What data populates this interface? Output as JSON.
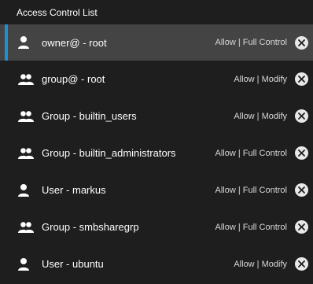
{
  "header": {
    "title": "Access Control List"
  },
  "acl": {
    "entries": [
      {
        "label": "owner@ - root",
        "permission": "Allow | Full Control",
        "icon": "person-icon",
        "selected": true
      },
      {
        "label": "group@ - root",
        "permission": "Allow | Modify",
        "icon": "group-icon"
      },
      {
        "label": "Group - builtin_users",
        "permission": "Allow | Modify",
        "icon": "group-icon"
      },
      {
        "label": "Group - builtin_administrators",
        "permission": "Allow | Full Control",
        "icon": "group-icon"
      },
      {
        "label": "User - markus",
        "permission": "Allow | Full Control",
        "icon": "person-icon"
      },
      {
        "label": "Group - smbsharegrp",
        "permission": "Allow | Full Control",
        "icon": "group-icon"
      },
      {
        "label": "User - ubuntu",
        "permission": "Allow | Modify",
        "icon": "person-icon"
      }
    ]
  },
  "colors": {
    "background": "#1e1e1e",
    "selected_row": "#444444",
    "accent": "#1e90d6",
    "remove_icon": "#e8e8e8"
  }
}
